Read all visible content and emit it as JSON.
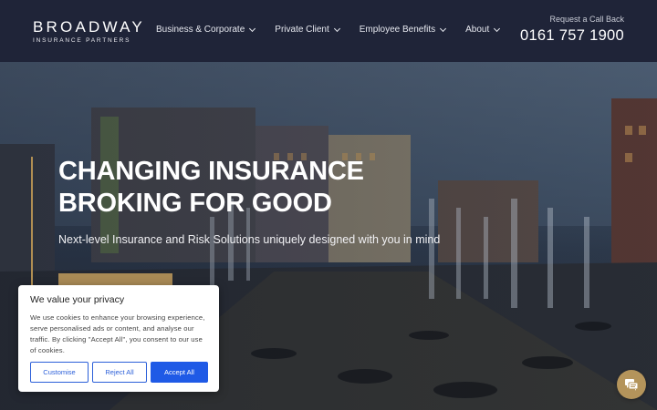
{
  "brand": {
    "logo_main": "BROADWAY",
    "logo_sub": "INSURANCE PARTNERS"
  },
  "nav": {
    "items": [
      {
        "label": "Business & Corporate"
      },
      {
        "label": "Private Client"
      },
      {
        "label": "Employee Benefits"
      },
      {
        "label": "About"
      }
    ]
  },
  "contact": {
    "callback_label": "Request a Call Back",
    "phone": "0161 757 1900"
  },
  "hero": {
    "title": "CHANGING INSURANCE BROKING FOR GOOD",
    "subtitle": "Next-level Insurance and Risk Solutions uniquely designed with you in mind"
  },
  "cookie": {
    "title": "We value your privacy",
    "text": "We use cookies to enhance your browsing experience, serve personalised ads or content, and analyse our traffic. By clicking \"Accept All\", you consent to our use of cookies.",
    "customise": "Customise",
    "reject": "Reject All",
    "accept": "Accept All"
  },
  "colors": {
    "header_bg": "#1f2438",
    "gold_accent": "#a98a55",
    "cookie_button_blue": "#1f5ae6",
    "chat_button": "#b4945b"
  },
  "icons": {
    "chat": "chat-bubble-icon",
    "chevron": "chevron-down-icon"
  }
}
